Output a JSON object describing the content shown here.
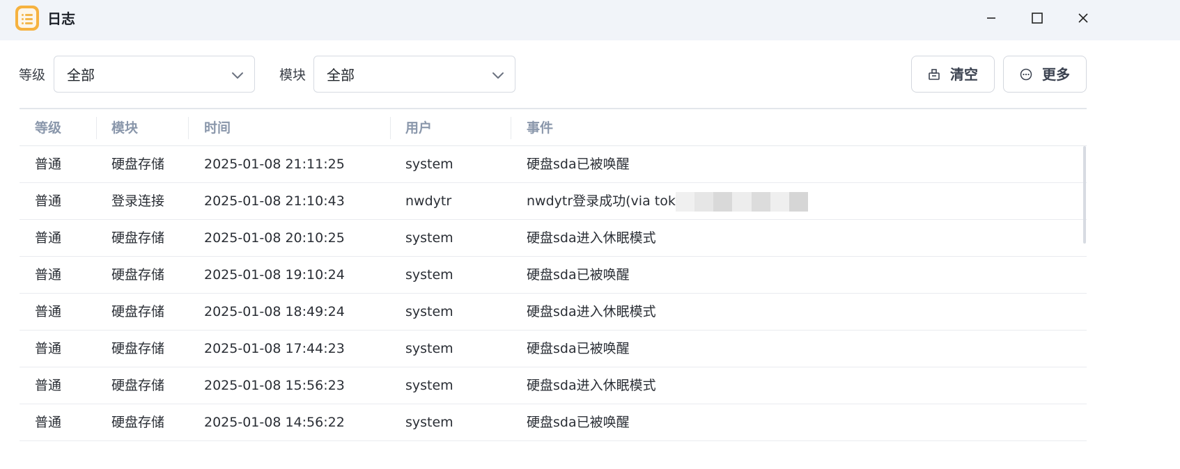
{
  "window": {
    "title": "日志",
    "icon": "log-app-icon",
    "controls": [
      "minimize-icon",
      "maximize-icon",
      "close-icon"
    ]
  },
  "toolbar": {
    "level_label": "等级",
    "level_value": "全部",
    "module_label": "模块",
    "module_value": "全部",
    "clear_label": "清空",
    "more_label": "更多"
  },
  "table": {
    "headers": {
      "level": "等级",
      "module": "模块",
      "time": "时间",
      "user": "用户",
      "event": "事件"
    },
    "rows": [
      {
        "level": "普通",
        "module": "硬盘存储",
        "time": "2025-01-08 21:11:25",
        "user": "system",
        "event": "硬盘sda已被唤醒"
      },
      {
        "level": "普通",
        "module": "登录连接",
        "time": "2025-01-08 21:10:43",
        "user": "nwdytr",
        "event": "nwdytr登录成功(via toke"
      },
      {
        "level": "普通",
        "module": "硬盘存储",
        "time": "2025-01-08 20:10:25",
        "user": "system",
        "event": "硬盘sda进入休眠模式"
      },
      {
        "level": "普通",
        "module": "硬盘存储",
        "time": "2025-01-08 19:10:24",
        "user": "system",
        "event": "硬盘sda已被唤醒"
      },
      {
        "level": "普通",
        "module": "硬盘存储",
        "time": "2025-01-08 18:49:24",
        "user": "system",
        "event": "硬盘sda进入休眠模式"
      },
      {
        "level": "普通",
        "module": "硬盘存储",
        "time": "2025-01-08 17:44:23",
        "user": "system",
        "event": "硬盘sda已被唤醒"
      },
      {
        "level": "普通",
        "module": "硬盘存储",
        "time": "2025-01-08 15:56:23",
        "user": "system",
        "event": "硬盘sda进入休眠模式"
      },
      {
        "level": "普通",
        "module": "硬盘存储",
        "time": "2025-01-08 14:56:22",
        "user": "system",
        "event": "硬盘sda已被唤醒"
      }
    ]
  },
  "colors": {
    "titlebar_bg": "#f1f4f9",
    "app_icon": "#f6b23f",
    "header_text": "#8a97ab"
  }
}
